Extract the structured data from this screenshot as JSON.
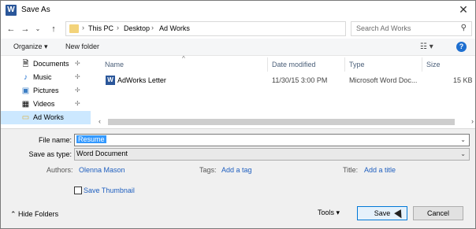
{
  "window": {
    "title": "Save As",
    "app_icon": "word-icon",
    "app_icon_glyph": "W"
  },
  "address": {
    "breadcrumbs": [
      "This PC",
      "Desktop",
      "Ad Works"
    ],
    "search_placeholder": "Search Ad Works"
  },
  "toolbar": {
    "organize_label": "Organize ▾",
    "new_folder_label": "New folder"
  },
  "sidebar": {
    "items": [
      {
        "label": "Documents",
        "icon": "documents-icon",
        "glyph": "🗎",
        "pinned": true
      },
      {
        "label": "Music",
        "icon": "music-icon",
        "glyph": "♪",
        "pinned": true
      },
      {
        "label": "Pictures",
        "icon": "pictures-icon",
        "glyph": "▣",
        "pinned": true
      },
      {
        "label": "Videos",
        "icon": "videos-icon",
        "glyph": "▦",
        "pinned": true
      },
      {
        "label": "Ad Works",
        "icon": "folder-icon",
        "glyph": "▭",
        "pinned": false,
        "selected": true
      }
    ]
  },
  "filelist": {
    "columns": [
      "Name",
      "Date modified",
      "Type",
      "Size"
    ],
    "rows": [
      {
        "name": "AdWorks Letter",
        "date": "11/30/15 3:00 PM",
        "type": "Microsoft Word Doc...",
        "size": "15 KB"
      }
    ]
  },
  "form": {
    "file_name_label": "File name:",
    "file_name_value": "Resume",
    "save_type_label": "Save as type:",
    "save_type_value": "Word Document",
    "authors_label": "Authors:",
    "authors_value": "Olenna Mason",
    "tags_label": "Tags:",
    "tags_value": "Add a tag",
    "title_label": "Title:",
    "title_value": "Add a title",
    "thumbnail_label": "Save Thumbnail",
    "thumbnail_checked": false
  },
  "footer": {
    "hide_folders_label": "Hide Folders",
    "tools_label": "Tools",
    "save_label": "Save",
    "cancel_label": "Cancel"
  },
  "colors": {
    "accent": "#0078d7",
    "link": "#1f5fbf",
    "selection": "#cce8ff"
  }
}
